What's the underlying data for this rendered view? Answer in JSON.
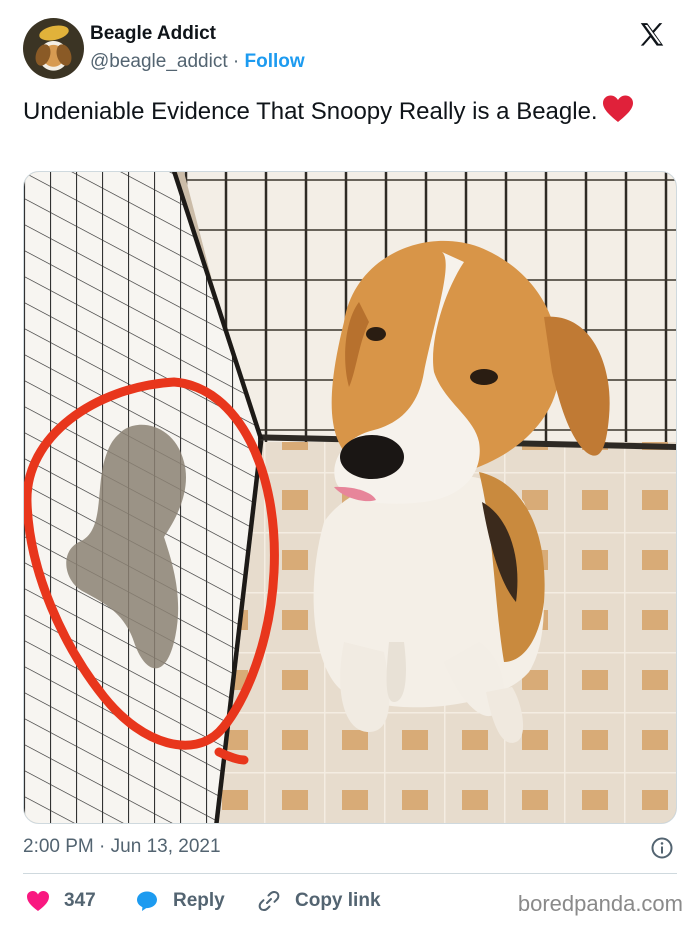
{
  "author": {
    "name": "Beagle Addict",
    "handle": "@beagle_addict",
    "separator": "·",
    "follow_label": "Follow"
  },
  "tweet": {
    "text": "Undeniable Evidence That Snoopy Really is a Beagle.",
    "emoji": "red-heart"
  },
  "meta": {
    "time": "2:00 PM",
    "separator": "·",
    "date": "Jun 13, 2021"
  },
  "actions": {
    "likes": "347",
    "reply_label": "Reply",
    "copy_label": "Copy link"
  },
  "watermark": "boredpanda.com",
  "colors": {
    "link": "#1d9bf0",
    "like": "#f91880",
    "reply": "#1d9bf0",
    "circle": "#e8361c"
  },
  "icons": [
    "x-logo-icon",
    "heart-icon",
    "reply-bubble-icon",
    "link-icon",
    "info-icon"
  ]
}
